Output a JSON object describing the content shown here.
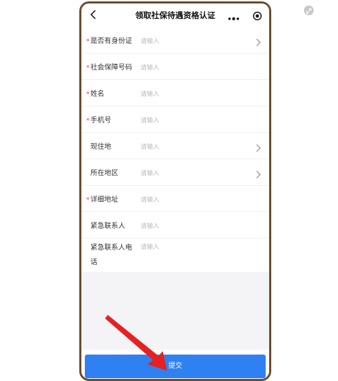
{
  "navbar": {
    "title": "领取社保待遇资格认证"
  },
  "form": {
    "fields": [
      {
        "label": "是否有身份证",
        "required": "*",
        "placeholder": "请输入",
        "has_chevron": true
      },
      {
        "label": "社会保障号码",
        "required": "*",
        "placeholder": "请输入",
        "has_chevron": false
      },
      {
        "label": "姓名",
        "required": "*",
        "placeholder": "请输入",
        "has_chevron": false
      },
      {
        "label": "手机号",
        "required": "*",
        "placeholder": "请输入",
        "has_chevron": false
      },
      {
        "label": "现住地",
        "required": "",
        "placeholder": "请输入",
        "has_chevron": true
      },
      {
        "label": "所在地区",
        "required": "",
        "placeholder": "请输入",
        "has_chevron": true
      },
      {
        "label": "详细地址",
        "required": "*",
        "placeholder": "请输入",
        "has_chevron": false
      },
      {
        "label": "紧急联系人",
        "required": "",
        "placeholder": "请输入",
        "has_chevron": false
      },
      {
        "label": "紧急联系人电话",
        "required": "",
        "placeholder": "请输入",
        "has_chevron": false
      }
    ]
  },
  "submit": {
    "label": "提交"
  },
  "colors": {
    "accent": "#2f80f0",
    "required": "#e33333",
    "frame": "#6b4a2c",
    "arrow": "#e52121"
  },
  "icons": [
    "back-icon",
    "more-dots-icon",
    "target-icon",
    "chevron-right-icon",
    "red-pointer-arrow",
    "link-icon"
  ]
}
